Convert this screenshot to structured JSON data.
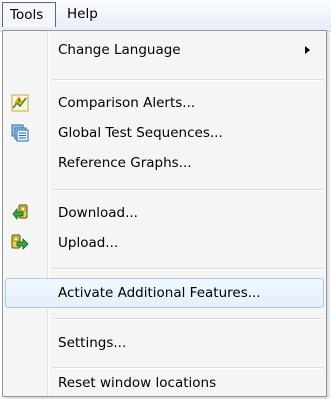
{
  "menubar": {
    "tools_label": "Tools",
    "help_label": "Help"
  },
  "menu": {
    "items": [
      {
        "label": "Change Language",
        "has_submenu": true,
        "icon": null
      },
      {
        "label": "Comparison Alerts...",
        "icon": "comparison-alerts-icon"
      },
      {
        "label": "Global Test Sequences...",
        "icon": "test-sequences-icon"
      },
      {
        "label": "Reference Graphs...",
        "icon": null
      },
      {
        "label": "Download...",
        "icon": "download-icon"
      },
      {
        "label": "Upload...",
        "icon": "upload-icon"
      },
      {
        "label": "Activate Additional Features...",
        "icon": null,
        "highlighted": true
      },
      {
        "label": "Settings...",
        "icon": null
      },
      {
        "label": "Reset window locations",
        "icon": null
      }
    ]
  },
  "colors": {
    "highlight_border": "#a9cdee",
    "highlight_fill": "#e3effc",
    "menu_background": "#f5f5f5"
  }
}
